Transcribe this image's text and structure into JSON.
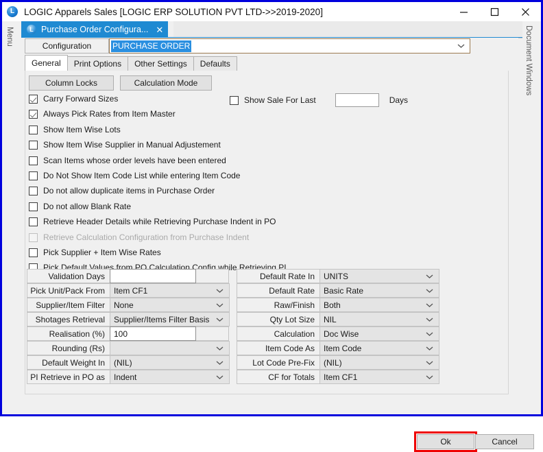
{
  "window": {
    "title": "LOGIC Apparels Sales  [LOGIC ERP SOLUTION PVT LTD->>2019-2020]",
    "app_logo_letter": "L",
    "minimize_icon": "minimize-icon",
    "maximize_icon": "maximize-icon",
    "close_icon": "close-icon"
  },
  "side_panels": {
    "left_label": "Menu",
    "right_label": "Document Windows"
  },
  "document_tab": {
    "label": "Purchase Order Configura...",
    "icon_letter": "L",
    "close_glyph": "✕"
  },
  "configuration": {
    "label": "Configuration",
    "value": "PURCHASE ORDER"
  },
  "tabs": [
    {
      "label": "General",
      "active": true
    },
    {
      "label": "Print Options",
      "active": false
    },
    {
      "label": "Other Settings",
      "active": false
    },
    {
      "label": "Defaults",
      "active": false
    }
  ],
  "buttons": {
    "column_locks": "Column Locks",
    "calculation_mode": "Calculation Mode",
    "ok": "Ok",
    "cancel": "Cancel"
  },
  "checkboxes": [
    {
      "label": "Carry Forward Sizes",
      "checked": true,
      "disabled": false
    },
    {
      "label": "Always Pick Rates from Item Master",
      "checked": true,
      "disabled": false
    },
    {
      "label": "Show Item Wise Lots",
      "checked": false,
      "disabled": false
    },
    {
      "label": "Show Item Wise Supplier in Manual Adjustement",
      "checked": false,
      "disabled": false
    },
    {
      "label": "Scan Items whose order levels have been entered",
      "checked": false,
      "disabled": false
    },
    {
      "label": "Do Not Show Item Code List while entering Item Code",
      "checked": false,
      "disabled": false
    },
    {
      "label": "Do not allow duplicate items in Purchase Order",
      "checked": false,
      "disabled": false
    },
    {
      "label": "Do not allow Blank Rate",
      "checked": false,
      "disabled": false
    },
    {
      "label": "Retrieve Header Details while Retrieving Purchase Indent in PO",
      "checked": false,
      "disabled": false
    },
    {
      "label": "Retrieve Calculation Configuration from Purchase Indent",
      "checked": false,
      "disabled": true
    },
    {
      "label": "Pick Supplier + Item Wise Rates",
      "checked": false,
      "disabled": false
    },
    {
      "label": "Pick Default Values from PO Calculation Config while Retrieving PI",
      "checked": false,
      "disabled": false
    }
  ],
  "show_sale": {
    "label": "Show Sale For Last",
    "checked": false,
    "value": "",
    "unit_label": "Days"
  },
  "fields_left": [
    {
      "label": "Validation Days",
      "value": "",
      "type": "text"
    },
    {
      "label": "Pick Unit/Pack From",
      "value": "Item CF1",
      "type": "combo"
    },
    {
      "label": "Supplier/Item Filter",
      "value": "None",
      "type": "combo"
    },
    {
      "label": "Shotages Retrieval",
      "value": "Supplier/Items Filter Basis",
      "type": "combo"
    },
    {
      "label": "Realisation (%)",
      "value": "100",
      "type": "text"
    },
    {
      "label": "Rounding  (Rs)",
      "value": "",
      "type": "combo"
    },
    {
      "label": "Default Weight In",
      "value": "(NIL)",
      "type": "combo"
    },
    {
      "label": "PI Retrieve in PO as",
      "value": "Indent",
      "type": "combo"
    }
  ],
  "fields_right": [
    {
      "label": "Default Rate In",
      "value": "UNITS",
      "type": "combo"
    },
    {
      "label": "Default Rate",
      "value": "Basic Rate",
      "type": "combo"
    },
    {
      "label": "Raw/Finish",
      "value": "Both",
      "type": "combo"
    },
    {
      "label": "Qty Lot Size",
      "value": "NIL",
      "type": "combo"
    },
    {
      "label": "Calculation",
      "value": "Doc Wise",
      "type": "combo"
    },
    {
      "label": "Item Code As",
      "value": "Item Code",
      "type": "combo"
    },
    {
      "label": "Lot Code Pre-Fix",
      "value": "(NIL)",
      "type": "combo"
    },
    {
      "label": "CF for Totals",
      "value": "Item CF1",
      "type": "combo"
    }
  ],
  "colors": {
    "window_border": "#0000dd",
    "active_tab": "#1f8ad2",
    "selection": "#2a8fe0",
    "highlight_border": "#ee0000",
    "panel_bg": "#f0f0f0"
  }
}
